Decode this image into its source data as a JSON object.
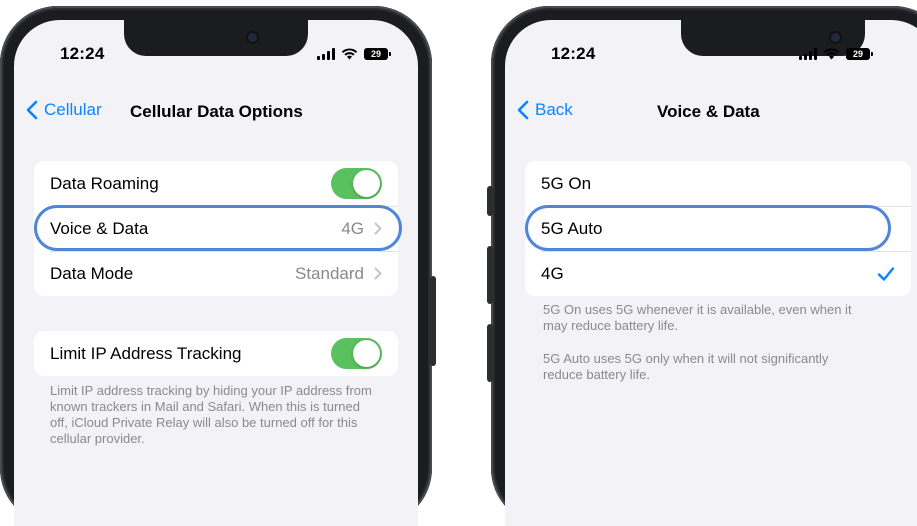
{
  "status_bar": {
    "time": "12:24",
    "battery": "29"
  },
  "left_screen": {
    "back_label": "Cellular",
    "title": "Cellular Data Options",
    "group1": [
      {
        "label": "Data Roaming",
        "toggle": true
      },
      {
        "label": "Voice & Data",
        "value": "4G"
      },
      {
        "label": "Data Mode",
        "value": "Standard"
      }
    ],
    "group2": {
      "label": "Limit IP Address Tracking",
      "toggle": true
    },
    "footnote": "Limit IP address tracking by hiding your IP address from known trackers in Mail and Safari. When this is turned off, iCloud Private Relay will also be turned off for this cellular provider."
  },
  "right_screen": {
    "back_label": "Back",
    "title": "Voice & Data",
    "options": [
      {
        "label": "5G On",
        "selected": false
      },
      {
        "label": "5G Auto",
        "selected": false
      },
      {
        "label": "4G",
        "selected": true
      }
    ],
    "footnote1": "5G On uses 5G whenever it is available, even when it may reduce battery life.",
    "footnote2": "5G Auto uses 5G only when it will not significantly reduce battery life."
  },
  "colors": {
    "accent": "#0a84ff",
    "toggle_on": "#5ac15f",
    "highlight": "#4f86d9"
  }
}
